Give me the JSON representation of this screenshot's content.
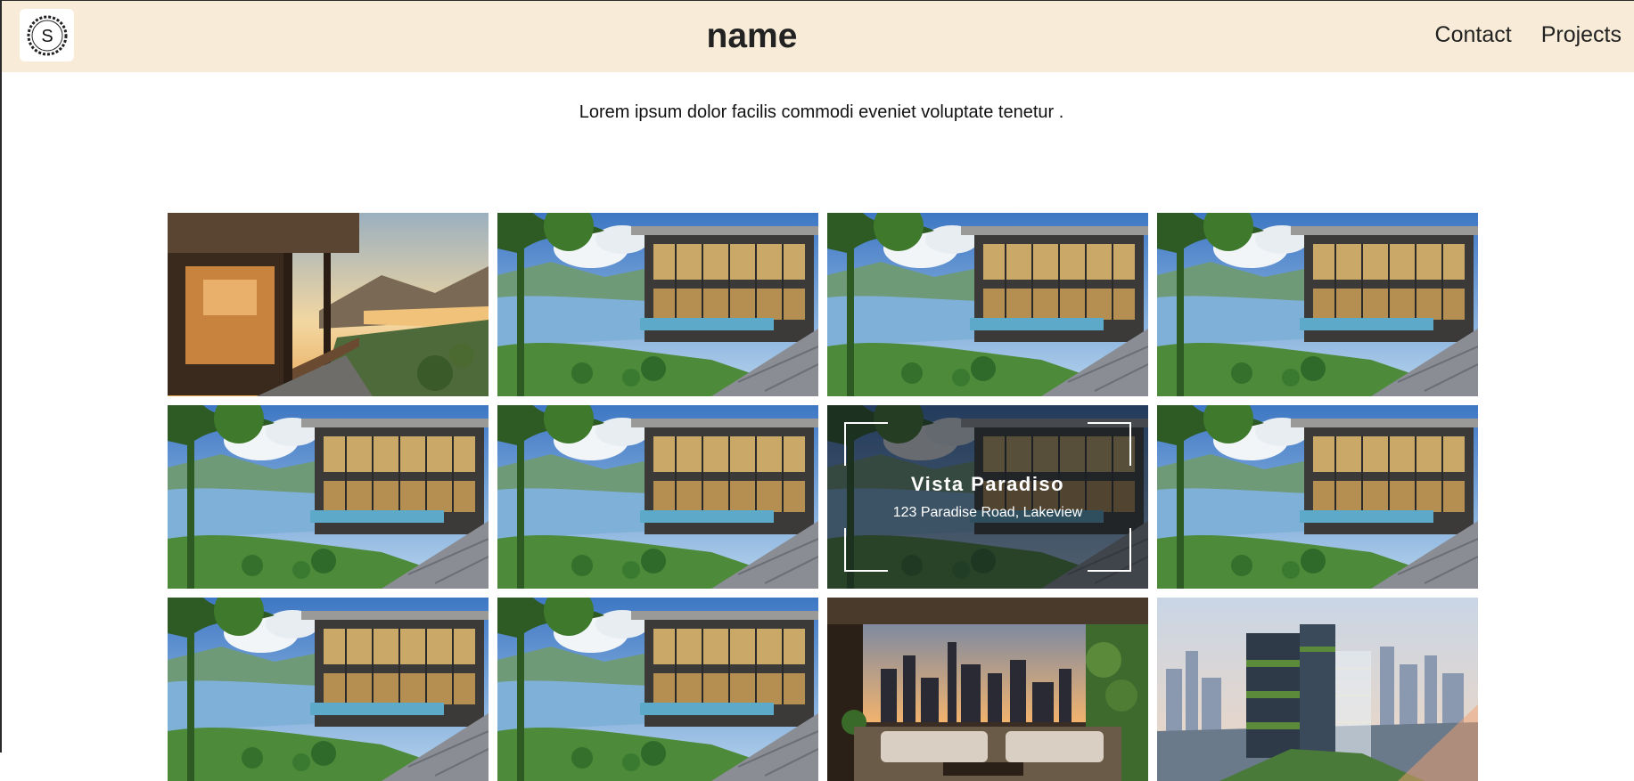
{
  "header": {
    "logo_letter": "S",
    "title": "name",
    "nav": [
      "Contact",
      "Projects"
    ]
  },
  "intro": "Lorem ipsum dolor facilis commodi eveniet voluptate tenetur .",
  "gallery": {
    "hover_item": {
      "title": "Vista Paradiso",
      "address": "123 Paradise Road, Lakeview"
    },
    "tiles": [
      {
        "scene": "sunset-terrace"
      },
      {
        "scene": "lake-villa"
      },
      {
        "scene": "lake-villa"
      },
      {
        "scene": "lake-villa"
      },
      {
        "scene": "lake-villa"
      },
      {
        "scene": "lake-villa"
      },
      {
        "scene": "lake-villa-hover"
      },
      {
        "scene": "lake-villa"
      },
      {
        "scene": "lake-villa"
      },
      {
        "scene": "lake-villa"
      },
      {
        "scene": "city-lounge"
      },
      {
        "scene": "city-tower"
      }
    ]
  }
}
